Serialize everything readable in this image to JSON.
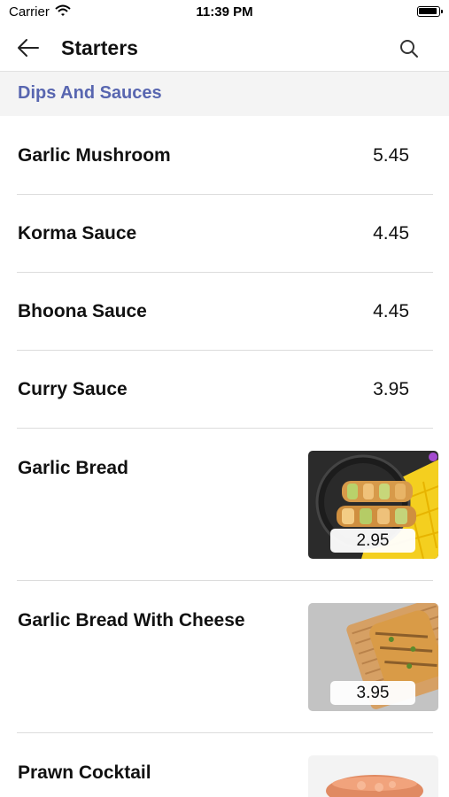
{
  "status": {
    "carrier": "Carrier",
    "time": "11:39 PM"
  },
  "nav": {
    "title": "Starters"
  },
  "section": {
    "title": "Dips And Sauces"
  },
  "items": [
    {
      "name": "Garlic Mushroom",
      "price": "5.45"
    },
    {
      "name": "Korma Sauce",
      "price": "4.45"
    },
    {
      "name": "Bhoona Sauce",
      "price": "4.45"
    },
    {
      "name": "Curry Sauce",
      "price": "3.95"
    },
    {
      "name": "Garlic Bread",
      "price": "2.95",
      "image": "garlic-bread-pan-photo"
    },
    {
      "name": "Garlic Bread With Cheese",
      "price": "3.95",
      "image": "cheese-garlic-bread-board-photo"
    },
    {
      "name": "Prawn Cocktail",
      "image": "prawn-cocktail-bowl-photo"
    }
  ],
  "colors": {
    "section_title": "#5866b0",
    "section_bg": "#f4f4f4",
    "divider": "#dcdcdc"
  }
}
